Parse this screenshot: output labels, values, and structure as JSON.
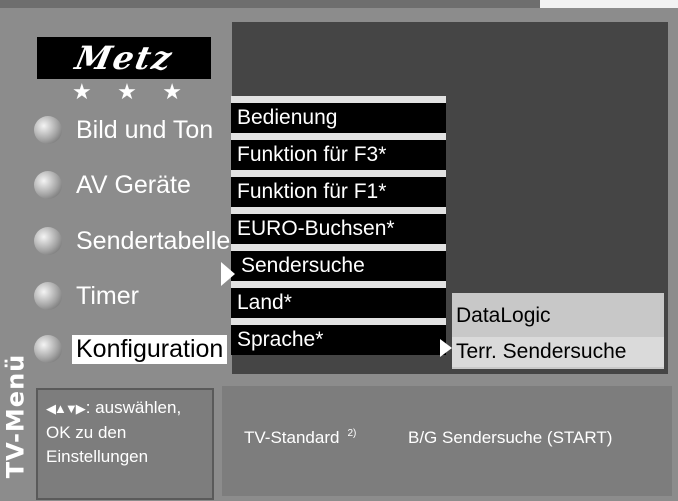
{
  "menu_title": "TV-Menü",
  "logo": {
    "brand": "Metz",
    "stars": "★ ★ ★"
  },
  "main_menu": {
    "items": [
      {
        "label": "Bild und Ton"
      },
      {
        "label": "AV Geräte"
      },
      {
        "label": "Sendertabelle"
      },
      {
        "label": "Timer"
      },
      {
        "label": "Konfiguration",
        "selected": true
      }
    ]
  },
  "submenu": {
    "items": [
      {
        "label": "Bedienung"
      },
      {
        "label": "Funktion für F3*"
      },
      {
        "label": "Funktion für F1*"
      },
      {
        "label": "EURO-Buchsen*"
      },
      {
        "label": "Sendersuche",
        "selected": true
      },
      {
        "label": "Land*"
      },
      {
        "label": "Sprache*"
      }
    ]
  },
  "sub_submenu": {
    "items": [
      {
        "label": "DataLogic"
      },
      {
        "label": "Terr. Sendersuche",
        "selected": true
      }
    ]
  },
  "help": {
    "icon": "◀▲▼▶",
    "line1": ": auswählen,",
    "line2": "OK zu den",
    "line3": "Einstellungen"
  },
  "info_bar": {
    "standard_label": "TV-Standard",
    "footnote_mark": "2)",
    "search_label": "B/G Sendersuche (START)"
  },
  "colors": {
    "background": "#8c8c8c",
    "screen_panel": "#454545",
    "submenu_bar": "#000000",
    "highlight": "#ffffff"
  }
}
